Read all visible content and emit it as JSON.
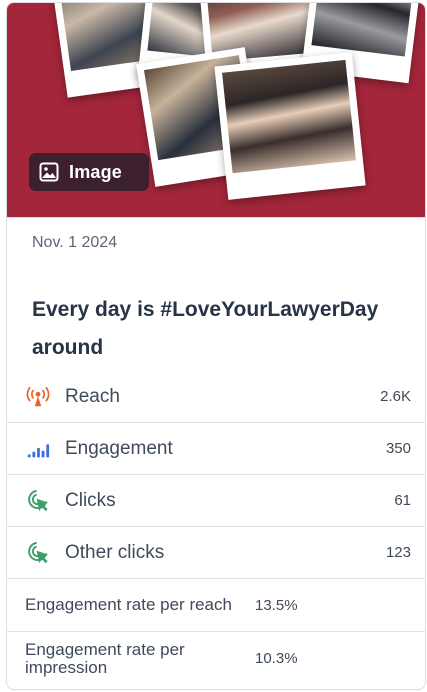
{
  "media": {
    "type_badge": "Image",
    "badge_icon": "image-icon"
  },
  "post": {
    "date": "Nov. 1 2024",
    "title": "Every day is #LoveYourLawyerDay around"
  },
  "metrics": [
    {
      "label": "Reach",
      "value": "2.6K",
      "icon": "broadcast-tower-icon",
      "icon_color": "#e8622a"
    },
    {
      "label": "Engagement",
      "value": "350",
      "icon": "bar-chart-icon",
      "icon_color": "#3a6fd8"
    },
    {
      "label": "Clicks",
      "value": "61",
      "icon": "cursor-click-icon",
      "icon_color": "#3aa06a"
    },
    {
      "label": "Other clicks",
      "value": "123",
      "icon": "cursor-click-icon",
      "icon_color": "#3aa06a"
    },
    {
      "label": "Engagement rate per reach",
      "value": "13.5%"
    },
    {
      "label": "Engagement rate per impression",
      "value": "10.3%"
    }
  ],
  "colors": {
    "media_background": "#a3263a",
    "title_text": "#273447"
  }
}
